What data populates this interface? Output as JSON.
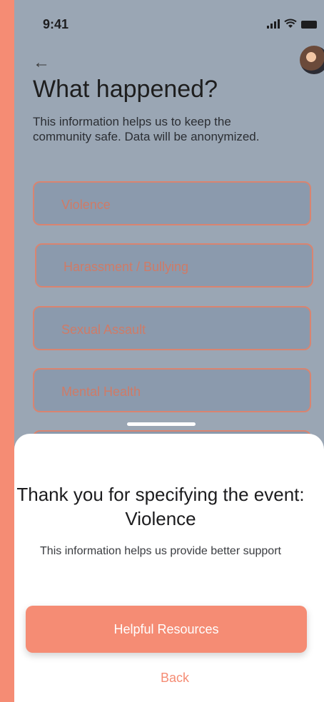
{
  "status": {
    "time": "9:41"
  },
  "header": {
    "title": "What happened?",
    "description": "This information helps us to keep the community safe. Data will be anonymized."
  },
  "options": [
    {
      "label": "Violence"
    },
    {
      "label": "Harassment / Bullying"
    },
    {
      "label": "Sexual Assault"
    },
    {
      "label": "Mental Health"
    }
  ],
  "sheet": {
    "title": "Thank you for specifying the event: Violence",
    "description": "This information helps us provide better support",
    "primary_label": "Helpful Resources",
    "secondary_label": "Back"
  },
  "colors": {
    "accent": "#F58C74",
    "overlay_bg": "#9AA6B4",
    "option_text": "#CF7B67"
  },
  "icons": {
    "back": "back-arrow-icon",
    "avatar": "avatar"
  }
}
